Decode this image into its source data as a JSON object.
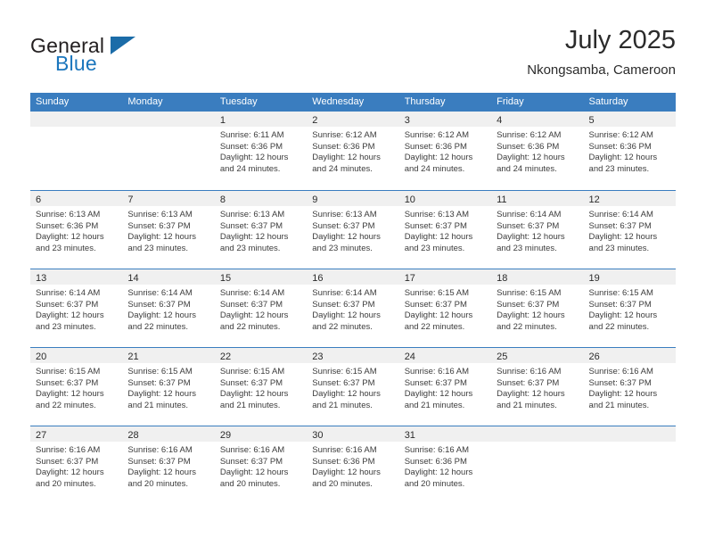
{
  "brand": {
    "name_part1": "General",
    "name_part2": "Blue",
    "logo_icon": "triangle-logo-icon"
  },
  "header": {
    "title": "July 2025",
    "subtitle": "Nkongsamba, Cameroon"
  },
  "calendar": {
    "weekdays": [
      "Sunday",
      "Monday",
      "Tuesday",
      "Wednesday",
      "Thursday",
      "Friday",
      "Saturday"
    ],
    "header_bg": "#3a7dbf",
    "day_number_bg": "#f0f0f0",
    "weeks": [
      [
        {
          "day": "",
          "sunrise": "",
          "sunset": "",
          "daylight_line1": "",
          "daylight_line2": ""
        },
        {
          "day": "",
          "sunrise": "",
          "sunset": "",
          "daylight_line1": "",
          "daylight_line2": ""
        },
        {
          "day": "1",
          "sunrise": "Sunrise: 6:11 AM",
          "sunset": "Sunset: 6:36 PM",
          "daylight_line1": "Daylight: 12 hours",
          "daylight_line2": "and 24 minutes."
        },
        {
          "day": "2",
          "sunrise": "Sunrise: 6:12 AM",
          "sunset": "Sunset: 6:36 PM",
          "daylight_line1": "Daylight: 12 hours",
          "daylight_line2": "and 24 minutes."
        },
        {
          "day": "3",
          "sunrise": "Sunrise: 6:12 AM",
          "sunset": "Sunset: 6:36 PM",
          "daylight_line1": "Daylight: 12 hours",
          "daylight_line2": "and 24 minutes."
        },
        {
          "day": "4",
          "sunrise": "Sunrise: 6:12 AM",
          "sunset": "Sunset: 6:36 PM",
          "daylight_line1": "Daylight: 12 hours",
          "daylight_line2": "and 24 minutes."
        },
        {
          "day": "5",
          "sunrise": "Sunrise: 6:12 AM",
          "sunset": "Sunset: 6:36 PM",
          "daylight_line1": "Daylight: 12 hours",
          "daylight_line2": "and 23 minutes."
        }
      ],
      [
        {
          "day": "6",
          "sunrise": "Sunrise: 6:13 AM",
          "sunset": "Sunset: 6:36 PM",
          "daylight_line1": "Daylight: 12 hours",
          "daylight_line2": "and 23 minutes."
        },
        {
          "day": "7",
          "sunrise": "Sunrise: 6:13 AM",
          "sunset": "Sunset: 6:37 PM",
          "daylight_line1": "Daylight: 12 hours",
          "daylight_line2": "and 23 minutes."
        },
        {
          "day": "8",
          "sunrise": "Sunrise: 6:13 AM",
          "sunset": "Sunset: 6:37 PM",
          "daylight_line1": "Daylight: 12 hours",
          "daylight_line2": "and 23 minutes."
        },
        {
          "day": "9",
          "sunrise": "Sunrise: 6:13 AM",
          "sunset": "Sunset: 6:37 PM",
          "daylight_line1": "Daylight: 12 hours",
          "daylight_line2": "and 23 minutes."
        },
        {
          "day": "10",
          "sunrise": "Sunrise: 6:13 AM",
          "sunset": "Sunset: 6:37 PM",
          "daylight_line1": "Daylight: 12 hours",
          "daylight_line2": "and 23 minutes."
        },
        {
          "day": "11",
          "sunrise": "Sunrise: 6:14 AM",
          "sunset": "Sunset: 6:37 PM",
          "daylight_line1": "Daylight: 12 hours",
          "daylight_line2": "and 23 minutes."
        },
        {
          "day": "12",
          "sunrise": "Sunrise: 6:14 AM",
          "sunset": "Sunset: 6:37 PM",
          "daylight_line1": "Daylight: 12 hours",
          "daylight_line2": "and 23 minutes."
        }
      ],
      [
        {
          "day": "13",
          "sunrise": "Sunrise: 6:14 AM",
          "sunset": "Sunset: 6:37 PM",
          "daylight_line1": "Daylight: 12 hours",
          "daylight_line2": "and 23 minutes."
        },
        {
          "day": "14",
          "sunrise": "Sunrise: 6:14 AM",
          "sunset": "Sunset: 6:37 PM",
          "daylight_line1": "Daylight: 12 hours",
          "daylight_line2": "and 22 minutes."
        },
        {
          "day": "15",
          "sunrise": "Sunrise: 6:14 AM",
          "sunset": "Sunset: 6:37 PM",
          "daylight_line1": "Daylight: 12 hours",
          "daylight_line2": "and 22 minutes."
        },
        {
          "day": "16",
          "sunrise": "Sunrise: 6:14 AM",
          "sunset": "Sunset: 6:37 PM",
          "daylight_line1": "Daylight: 12 hours",
          "daylight_line2": "and 22 minutes."
        },
        {
          "day": "17",
          "sunrise": "Sunrise: 6:15 AM",
          "sunset": "Sunset: 6:37 PM",
          "daylight_line1": "Daylight: 12 hours",
          "daylight_line2": "and 22 minutes."
        },
        {
          "day": "18",
          "sunrise": "Sunrise: 6:15 AM",
          "sunset": "Sunset: 6:37 PM",
          "daylight_line1": "Daylight: 12 hours",
          "daylight_line2": "and 22 minutes."
        },
        {
          "day": "19",
          "sunrise": "Sunrise: 6:15 AM",
          "sunset": "Sunset: 6:37 PM",
          "daylight_line1": "Daylight: 12 hours",
          "daylight_line2": "and 22 minutes."
        }
      ],
      [
        {
          "day": "20",
          "sunrise": "Sunrise: 6:15 AM",
          "sunset": "Sunset: 6:37 PM",
          "daylight_line1": "Daylight: 12 hours",
          "daylight_line2": "and 22 minutes."
        },
        {
          "day": "21",
          "sunrise": "Sunrise: 6:15 AM",
          "sunset": "Sunset: 6:37 PM",
          "daylight_line1": "Daylight: 12 hours",
          "daylight_line2": "and 21 minutes."
        },
        {
          "day": "22",
          "sunrise": "Sunrise: 6:15 AM",
          "sunset": "Sunset: 6:37 PM",
          "daylight_line1": "Daylight: 12 hours",
          "daylight_line2": "and 21 minutes."
        },
        {
          "day": "23",
          "sunrise": "Sunrise: 6:15 AM",
          "sunset": "Sunset: 6:37 PM",
          "daylight_line1": "Daylight: 12 hours",
          "daylight_line2": "and 21 minutes."
        },
        {
          "day": "24",
          "sunrise": "Sunrise: 6:16 AM",
          "sunset": "Sunset: 6:37 PM",
          "daylight_line1": "Daylight: 12 hours",
          "daylight_line2": "and 21 minutes."
        },
        {
          "day": "25",
          "sunrise": "Sunrise: 6:16 AM",
          "sunset": "Sunset: 6:37 PM",
          "daylight_line1": "Daylight: 12 hours",
          "daylight_line2": "and 21 minutes."
        },
        {
          "day": "26",
          "sunrise": "Sunrise: 6:16 AM",
          "sunset": "Sunset: 6:37 PM",
          "daylight_line1": "Daylight: 12 hours",
          "daylight_line2": "and 21 minutes."
        }
      ],
      [
        {
          "day": "27",
          "sunrise": "Sunrise: 6:16 AM",
          "sunset": "Sunset: 6:37 PM",
          "daylight_line1": "Daylight: 12 hours",
          "daylight_line2": "and 20 minutes."
        },
        {
          "day": "28",
          "sunrise": "Sunrise: 6:16 AM",
          "sunset": "Sunset: 6:37 PM",
          "daylight_line1": "Daylight: 12 hours",
          "daylight_line2": "and 20 minutes."
        },
        {
          "day": "29",
          "sunrise": "Sunrise: 6:16 AM",
          "sunset": "Sunset: 6:37 PM",
          "daylight_line1": "Daylight: 12 hours",
          "daylight_line2": "and 20 minutes."
        },
        {
          "day": "30",
          "sunrise": "Sunrise: 6:16 AM",
          "sunset": "Sunset: 6:36 PM",
          "daylight_line1": "Daylight: 12 hours",
          "daylight_line2": "and 20 minutes."
        },
        {
          "day": "31",
          "sunrise": "Sunrise: 6:16 AM",
          "sunset": "Sunset: 6:36 PM",
          "daylight_line1": "Daylight: 12 hours",
          "daylight_line2": "and 20 minutes."
        },
        {
          "day": "",
          "sunrise": "",
          "sunset": "",
          "daylight_line1": "",
          "daylight_line2": ""
        },
        {
          "day": "",
          "sunrise": "",
          "sunset": "",
          "daylight_line1": "",
          "daylight_line2": ""
        }
      ]
    ]
  }
}
